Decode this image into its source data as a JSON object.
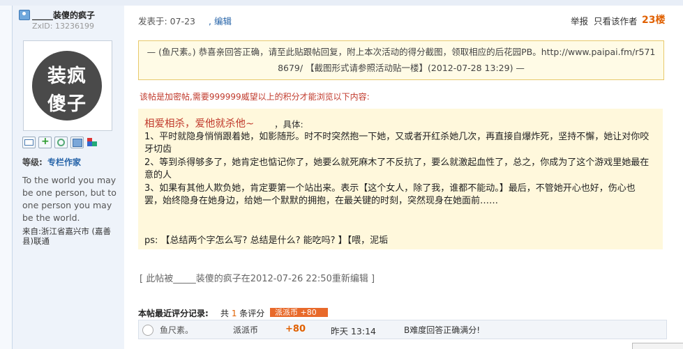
{
  "author": {
    "username": "_____装傻的疯子",
    "zxid": "ZxID:  13236199",
    "avatar_line1": "装疯",
    "avatar_line2": "傻子",
    "level_label": "等级:",
    "level_value": "专栏作家",
    "bio": "To the world you may be one person, but to one person you may be the world.",
    "from": "来自:浙江省嘉兴市 (嘉善县)联通"
  },
  "post": {
    "time": "发表于: 07-23",
    "edit": ", 编辑",
    "report": "举报",
    "only_author": "只看该作者",
    "floor": "23楼",
    "quote": "— (鱼尺素。) 恭喜亲回答正确，请至此贴跟帖回复，附上本次活动的得分截图，领取相应的后花园PB。http://www.paipai.fm/r5718679/ 【截图形式请参照活动贴一楼】(2012-07-28 13:29) —",
    "hidden_note": "该帖是加密帖,需要999999威望以上的积分才能浏览以下内容:",
    "hidden_title": "相爱相杀，爱他就杀他~",
    "hidden_title_suffix": "，具体:",
    "points": [
      "1、平时就隐身悄悄跟着她，如影随形。时不时突然抱一下她，又或者开红杀她几次，再直接自爆炸死，坚持不懈，她让对你咬牙切齿",
      "2、等到杀得够多了，她肯定也惦记你了，她要么就死麻木了不反抗了，要么就激起血性了，总之，你成为了这个游戏里她最在意的人",
      "3、如果有其他人欺负她，肯定要第一个站出来。表示【这个女人，除了我，谁都不能动。】最后，不管她开心也好，伤心也罢，始终隐身在她身边，给她一个默默的拥抱，在最关键的时刻，突然现身在她面前……"
    ],
    "ps": "ps: 【总结两个字怎么写? 总结是什么? 能吃吗? 】【喂，泥垢",
    "edited": "[ 此帖被_____装傻的疯子在2012-07-26 22:50重新编辑 ]"
  },
  "rating": {
    "label": "本帖最近评分记录:",
    "count_prefix": "共 ",
    "count_num": "1",
    "count_suffix": " 条评分",
    "tag": "派派币 +80",
    "rows": [
      {
        "user": "鱼尺素。",
        "type": "派派币",
        "amount": "+80",
        "time": "昨天 13:14",
        "reason": "B难度回答正确满分!"
      }
    ]
  },
  "colors": {
    "accent": "#e06000",
    "link": "#2563a8",
    "alert": "#c0392b"
  }
}
